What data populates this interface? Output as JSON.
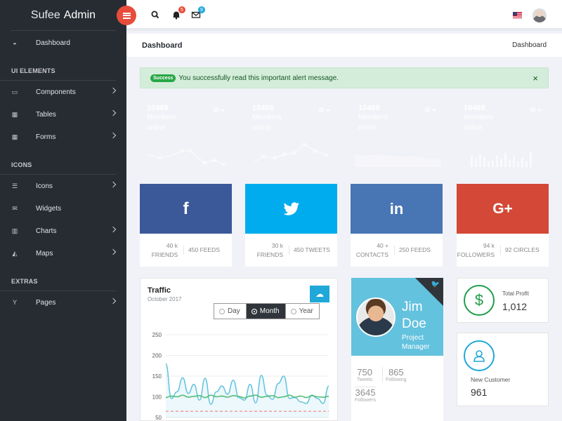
{
  "brand": {
    "prefix": "Sufee",
    "name": "Admin"
  },
  "sidebar": {
    "dashboard": "Dashboard",
    "sections": [
      "UI ELEMENTS",
      "ICONS",
      "EXTRAS"
    ],
    "items": [
      "Components",
      "Tables",
      "Forms",
      "Icons",
      "Widgets",
      "Charts",
      "Maps",
      "Pages"
    ]
  },
  "header": {
    "notif_count": "5",
    "msg_count": "9"
  },
  "breadcrumb": {
    "title": "Dashboard",
    "current": "Dashboard"
  },
  "alert": {
    "badge": "Success",
    "text": "You successfully read this important alert message.",
    "close": "×"
  },
  "stats": [
    {
      "value": "10468",
      "label1": "Members",
      "label2": "online",
      "color": "#20a8d8"
    },
    {
      "value": "10468",
      "label1": "Members",
      "label2": "online",
      "color": "#63c2de"
    },
    {
      "value": "10468",
      "label1": "Members",
      "label2": "online",
      "color": "#ffc107"
    },
    {
      "value": "10468",
      "label1": "Members",
      "label2": "online",
      "color": "#f86c6b"
    }
  ],
  "social": [
    {
      "icon": "facebook-icon",
      "glyph": "f",
      "color": "#3b5998",
      "a_value": "40 k",
      "a_label": "FRIENDS",
      "b_value": "450",
      "b_label": "FEEDS"
    },
    {
      "icon": "twitter-icon",
      "glyph": "🐦",
      "color": "#00aced",
      "a_value": "30 k",
      "a_label": "FRIENDS",
      "b_value": "450",
      "b_label": "TWEETS"
    },
    {
      "icon": "linkedin-icon",
      "glyph": "in",
      "color": "#4875b4",
      "a_value": "40 +",
      "a_label": "CONTACTS",
      "b_value": "250",
      "b_label": "FEEDS"
    },
    {
      "icon": "google-plus-icon",
      "glyph": "G+",
      "color": "#d34836",
      "a_value": "94 k",
      "a_label": "FOLLOWERS",
      "b_value": "92",
      "b_label": "CIRCLES"
    }
  ],
  "traffic": {
    "title": "Traffic",
    "subtitle": "October 2017",
    "options": [
      "Day",
      "Month",
      "Year"
    ],
    "selected": "Month"
  },
  "chart_data": {
    "type": "line",
    "yticks": [
      "250",
      "200",
      "150",
      "100",
      "50"
    ],
    "ylim": [
      50,
      250
    ],
    "series": [
      {
        "values": [
          180,
          96,
          112,
          146,
          108,
          130,
          92,
          145,
          82,
          112,
          126,
          106,
          140,
          98,
          92,
          130,
          85,
          152,
          104,
          94,
          132,
          150,
          96,
          98,
          88,
          84,
          104,
          96,
          84,
          126
        ],
        "color": "#63c2de"
      },
      {
        "values": [
          98,
          102,
          100,
          104,
          99,
          101,
          103,
          98,
          104,
          100,
          102,
          99,
          103,
          101,
          97,
          102,
          104,
          99,
          101,
          103,
          98,
          100,
          104,
          99,
          102,
          98,
          103,
          100,
          99,
          101
        ],
        "color": "#4dbd74"
      },
      {
        "values": [
          65,
          65,
          65,
          65,
          65,
          65,
          65,
          65,
          65,
          65,
          65,
          65,
          65,
          65,
          65,
          65,
          65,
          65,
          65,
          65,
          65,
          65,
          65,
          65,
          65,
          65,
          65,
          65,
          65,
          65
        ],
        "color": "#f86c6b"
      }
    ]
  },
  "profile": {
    "first": "Jim",
    "last": "Doe",
    "role1": "Project",
    "role2": "Manager",
    "tweets": "750",
    "tweets_label": "Tweets",
    "following": "865",
    "following_label": "Following",
    "followers": "3645",
    "followers_label": "Followers"
  },
  "profit": {
    "label": "Total Profit",
    "value": "1,012",
    "glyph": "$"
  },
  "customer": {
    "label": "New Customer",
    "value": "961"
  }
}
